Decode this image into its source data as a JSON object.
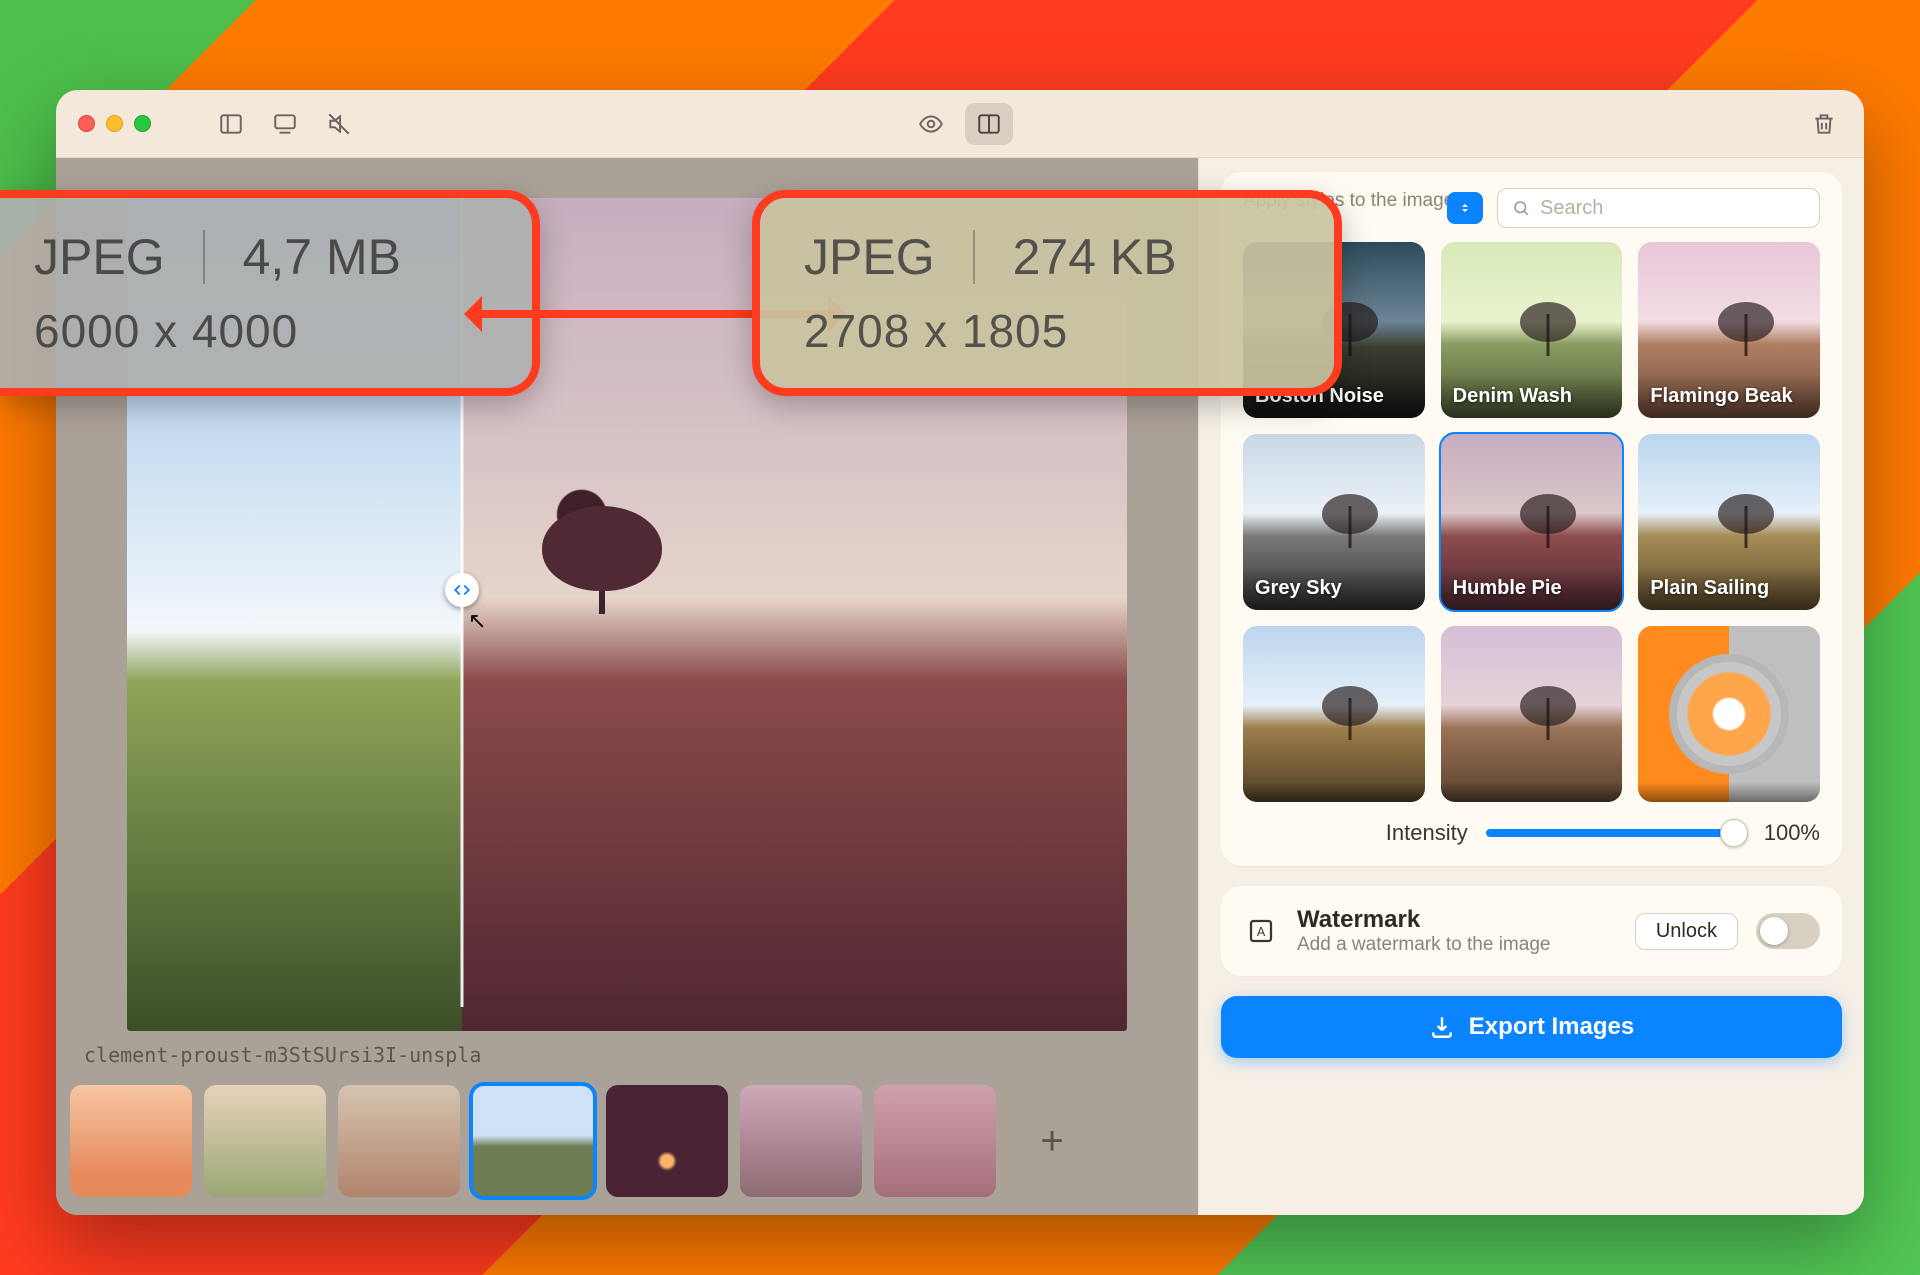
{
  "toolbar": {
    "preview_icon": "eye-icon",
    "compare_icon": "split-columns-icon",
    "sidebar_icon": "sidebar-left-icon",
    "display_icon": "display-icon",
    "mute_icon": "speaker-off-icon",
    "trash_icon": "trash-icon"
  },
  "callouts": {
    "original": {
      "format": "JPEG",
      "size": "4,7 MB",
      "dimensions": "6000 x 4000"
    },
    "result": {
      "format": "JPEG",
      "size": "274 KB",
      "dimensions": "2708 x 1805"
    }
  },
  "canvas": {
    "filename": "clement-proust-m3StSUrsi3I-unspla",
    "add_label": "+"
  },
  "sidebar": {
    "panel_subtitle": "Apply styles to the image",
    "search_placeholder": "Search",
    "styles": [
      {
        "label": "Boston Noise"
      },
      {
        "label": "Denim Wash"
      },
      {
        "label": "Flamingo Beak"
      },
      {
        "label": "Grey Sky"
      },
      {
        "label": "Humble Pie"
      },
      {
        "label": "Plain Sailing"
      },
      {
        "label": ""
      },
      {
        "label": ""
      },
      {
        "label": ""
      }
    ],
    "selected_style_index": 4,
    "intensity_label": "Intensity",
    "intensity_value": "100%",
    "watermark": {
      "title": "Watermark",
      "subtitle": "Add a watermark to the image",
      "unlock": "Unlock"
    },
    "export_label": "Export Images"
  },
  "thumbnails": {
    "selected_index": 3
  }
}
